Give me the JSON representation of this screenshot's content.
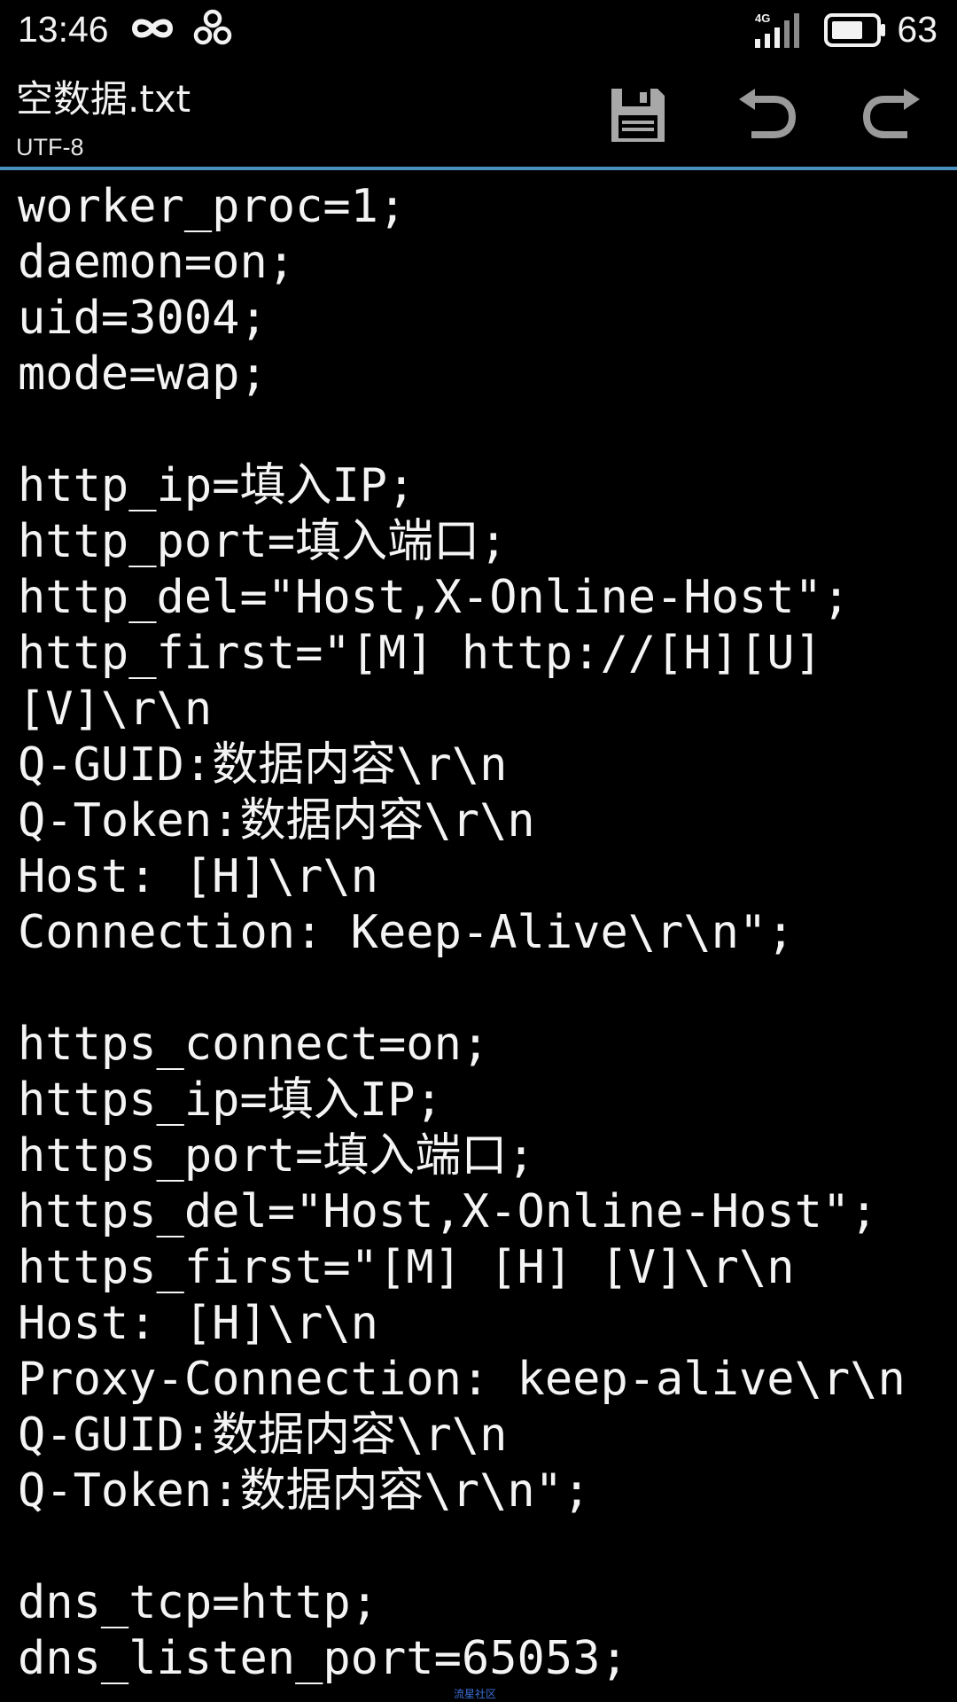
{
  "status_bar": {
    "time": "13:46",
    "network": "4G",
    "battery_level": "63",
    "icons": [
      "infinity-icon",
      "clover-icon",
      "signal-icon",
      "battery-icon"
    ]
  },
  "toolbar": {
    "file_name": "空数据.txt",
    "encoding": "UTF-8",
    "icons": [
      "save-icon",
      "undo-icon",
      "redo-icon"
    ]
  },
  "colors": {
    "accent_divider": "#4a8fbf",
    "background": "#000000",
    "text": "#f4f4f4",
    "disabled_icon": "#9a9a9a"
  },
  "editor": {
    "lines": [
      "worker_proc=1;",
      "daemon=on;",
      "uid=3004;",
      "mode=wap;",
      "",
      "http_ip=填入IP;",
      "http_port=填入端口;",
      "http_del=\"Host,X-Online-Host\";",
      "http_first=\"[M] http://[H][U]",
      "[V]\\r\\n",
      "Q-GUID:数据内容\\r\\n",
      "Q-Token:数据内容\\r\\n",
      "Host: [H]\\r\\n",
      "Connection: Keep-Alive\\r\\n\";",
      "",
      "https_connect=on;",
      "https_ip=填入IP;",
      "https_port=填入端口;",
      "https_del=\"Host,X-Online-Host\";",
      "https_first=\"[M] [H] [V]\\r\\n",
      "Host: [H]\\r\\n",
      "Proxy-Connection: keep-alive\\r\\n",
      "Q-GUID:数据内容\\r\\n",
      "Q-Token:数据内容\\r\\n\";",
      "",
      "dns_tcp=http;",
      "dns_listen_port=65053;"
    ]
  },
  "watermark": "流星社区"
}
